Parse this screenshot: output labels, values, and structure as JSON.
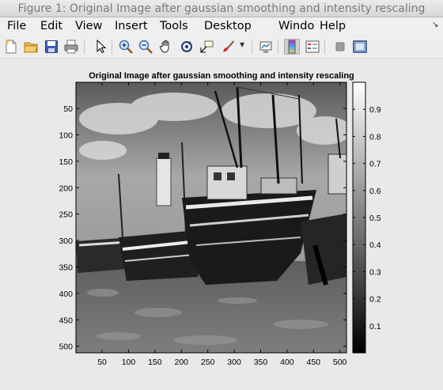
{
  "window": {
    "title": "Figure 1: Original Image after gaussian smoothing and intensity rescaling"
  },
  "menubar": {
    "items": [
      "File",
      "Edit",
      "View",
      "Insert",
      "Tools",
      "Desktop",
      "Windo",
      "Help"
    ],
    "corner_icon": "restore-arrow-icon"
  },
  "toolbar": {
    "buttons": [
      {
        "name": "new-figure",
        "icon": "new-file-icon"
      },
      {
        "name": "open-file",
        "icon": "open-folder-icon"
      },
      {
        "name": "save-figure",
        "icon": "save-disk-icon"
      },
      {
        "name": "print-figure",
        "icon": "printer-icon"
      },
      {
        "name": "edit-plot",
        "icon": "arrow-pointer-icon"
      },
      {
        "name": "zoom-in",
        "icon": "zoom-in-icon"
      },
      {
        "name": "zoom-out",
        "icon": "zoom-out-icon"
      },
      {
        "name": "pan",
        "icon": "hand-pan-icon"
      },
      {
        "name": "rotate-3d",
        "icon": "rotate-icon"
      },
      {
        "name": "data-cursor",
        "icon": "data-cursor-icon"
      },
      {
        "name": "brush",
        "icon": "brush-icon"
      },
      {
        "name": "link-plot",
        "icon": "link-plot-icon"
      },
      {
        "name": "insert-colorbar",
        "icon": "colorbar-icon"
      },
      {
        "name": "insert-legend",
        "icon": "legend-icon"
      },
      {
        "name": "hide-plot-tools",
        "icon": "gray-square-icon"
      },
      {
        "name": "show-plot-tools",
        "icon": "dock-window-icon"
      }
    ]
  },
  "chart_data": {
    "type": "image",
    "title": "Original Image after gaussian smoothing and intensity rescaling",
    "image_subject": "grayscale photograph of fishing boats on a beach at low tide",
    "xlim": [
      0.5,
      512.5
    ],
    "ylim": [
      0.5,
      512.5
    ],
    "x_ticks": [
      50,
      100,
      150,
      200,
      250,
      300,
      350,
      400,
      450,
      500
    ],
    "y_ticks": [
      50,
      100,
      150,
      200,
      250,
      300,
      350,
      400,
      450,
      500
    ],
    "colorbar": {
      "colormap": "gray",
      "range": [
        0,
        1
      ],
      "ticks": [
        0.1,
        0.2,
        0.3,
        0.4,
        0.5,
        0.6,
        0.7,
        0.8,
        0.9
      ]
    }
  }
}
